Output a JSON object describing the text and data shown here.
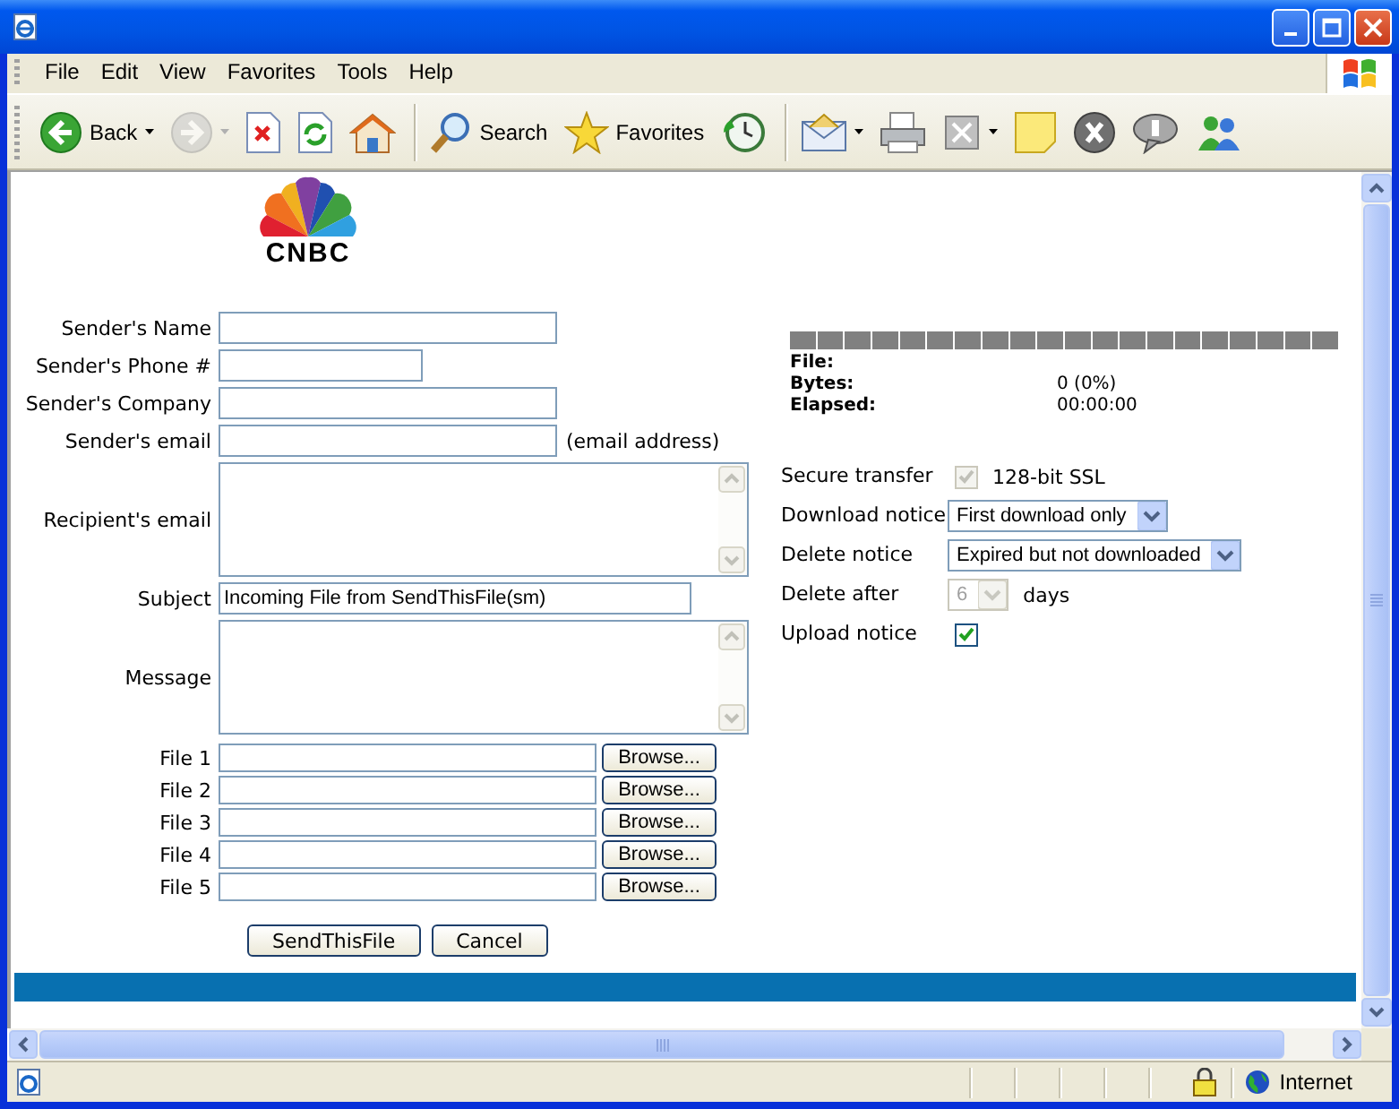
{
  "menu": [
    {
      "label": "File"
    },
    {
      "label": "Edit"
    },
    {
      "label": "View"
    },
    {
      "label": "Favorites"
    },
    {
      "label": "Tools"
    },
    {
      "label": "Help"
    }
  ],
  "toolbar": [
    {
      "kind": "back",
      "label": "Back",
      "disabled": false
    },
    {
      "kind": "forward",
      "disabled": true
    },
    {
      "kind": "stop",
      "disabled": false
    },
    {
      "kind": "refresh",
      "disabled": false
    },
    {
      "kind": "home",
      "disabled": false
    },
    {
      "kind": "search",
      "label": "Search",
      "disabled": false
    },
    {
      "kind": "favorites",
      "label": "Favorites",
      "disabled": false
    },
    {
      "kind": "history",
      "disabled": false
    },
    {
      "kind": "mail",
      "disabled": false
    },
    {
      "kind": "print",
      "disabled": false
    },
    {
      "kind": "edit",
      "disabled": false
    },
    {
      "kind": "note",
      "disabled": false
    },
    {
      "kind": "block",
      "disabled": false
    },
    {
      "kind": "discuss",
      "disabled": false
    },
    {
      "kind": "messenger",
      "disabled": false
    }
  ],
  "logo": {
    "text": "CNBC"
  },
  "form": {
    "fields": [
      {
        "label": "Sender's Name",
        "kind": "text"
      },
      {
        "label": "Sender's Phone #",
        "kind": "short"
      },
      {
        "label": "Sender's Company",
        "kind": "text"
      },
      {
        "label": "Sender's email",
        "kind": "text",
        "note": "(email address)"
      },
      {
        "label": "Recipient's email",
        "kind": "textarea"
      },
      {
        "label": "Subject",
        "kind": "long",
        "value": "Incoming File from SendThisFile(sm)"
      },
      {
        "label": "Message",
        "kind": "textarea"
      }
    ],
    "files": [
      {
        "label": "File 1",
        "button": "Browse..."
      },
      {
        "label": "File 2",
        "button": "Browse..."
      },
      {
        "label": "File 3",
        "button": "Browse..."
      },
      {
        "label": "File 4",
        "button": "Browse..."
      },
      {
        "label": "File 5",
        "button": "Browse..."
      }
    ],
    "buttons": [
      {
        "label": "SendThisFile"
      },
      {
        "label": "Cancel"
      }
    ]
  },
  "transfer": {
    "progress": {
      "level": 0
    },
    "info": [
      {
        "label": "File:"
      },
      {
        "label": "Bytes:",
        "value": "0 (0%)"
      },
      {
        "label": "Elapsed:",
        "value": "00:00:00"
      }
    ],
    "options": [
      {
        "kind": "checkbox",
        "label": "Secure transfer",
        "checked": true,
        "disabled": true,
        "text": "128-bit SSL"
      },
      {
        "kind": "select",
        "label": "Download notice",
        "value": "First download only",
        "disabled": false
      },
      {
        "kind": "select",
        "label": "Delete notice",
        "value": "Expired but not downloaded",
        "disabled": false
      },
      {
        "kind": "select",
        "label": "Delete after",
        "value": "6",
        "disabled": true,
        "text": "days"
      },
      {
        "kind": "checkbox",
        "label": "Upload notice",
        "checked": true,
        "disabled": false
      }
    ]
  },
  "status_bar": {
    "zone": "Internet"
  }
}
